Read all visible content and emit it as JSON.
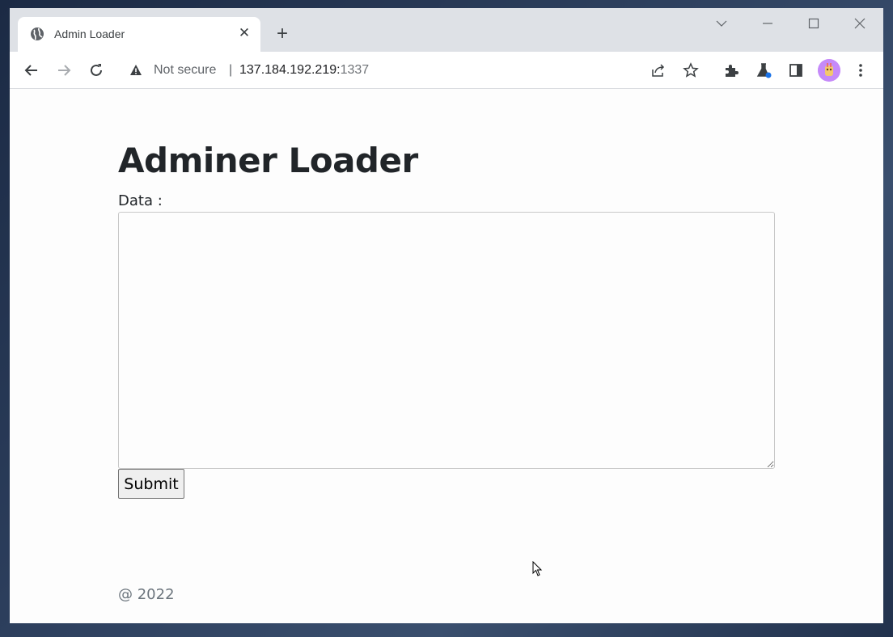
{
  "browser": {
    "tab_title": "Admin Loader",
    "security_label": "Not secure",
    "separator": "|",
    "url_host": "137.184.192.219:",
    "url_port": "1337"
  },
  "page": {
    "heading": "Adminer Loader",
    "data_label": "Data :",
    "textarea_value": "",
    "submit_label": "Submit",
    "footer": "@ 2022"
  },
  "icons": {
    "favicon": "globe-icon",
    "tab_close": "close-icon",
    "new_tab": "plus-icon",
    "back": "back-arrow-icon",
    "forward": "forward-arrow-icon",
    "reload": "reload-icon",
    "security": "warning-triangle-icon",
    "share": "share-icon",
    "bookmark": "star-icon",
    "extensions": "puzzle-icon",
    "labs": "flask-icon",
    "side_panel": "side-panel-icon",
    "menu": "kebab-menu-icon"
  },
  "colors": {
    "tab_strip": "#dee1e6",
    "text_dark": "#212529",
    "footer_text": "#6c757d"
  }
}
